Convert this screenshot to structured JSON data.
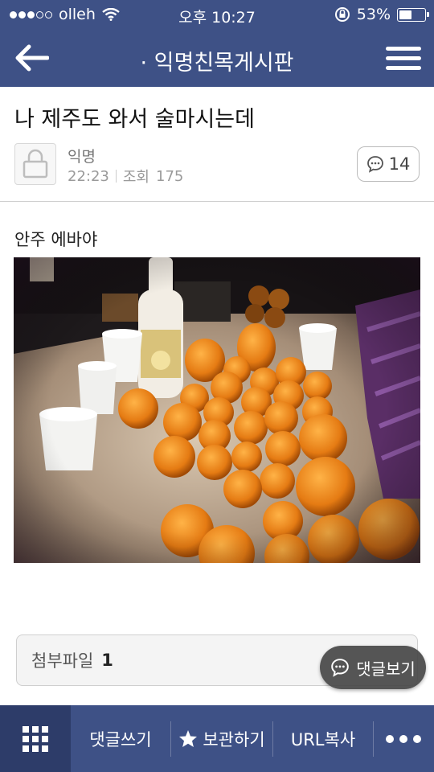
{
  "status_bar": {
    "carrier": "olleh",
    "time": "오후 10:27",
    "battery_text": "53%",
    "battery_level": 0.53
  },
  "nav": {
    "title": "· 익명친목게시판",
    "back_icon": "arrow-left-icon",
    "menu_icon": "hamburger-menu-icon"
  },
  "post": {
    "title": "나 제주도 와서 술마시는데",
    "author": "익명",
    "time": "22:23",
    "views_label": "조회",
    "views": "175",
    "comment_count": "14",
    "body": "안주 에바야"
  },
  "attachments": {
    "label": "첨부파일",
    "count": "1"
  },
  "floating": {
    "comment_view_label": "댓글보기"
  },
  "toolbar": {
    "write_comment": "댓글쓰기",
    "bookmark": "보관하기",
    "url_copy": "URL복사"
  },
  "colors": {
    "primary": "#3e5186",
    "primary_dark": "#2d3c69"
  }
}
